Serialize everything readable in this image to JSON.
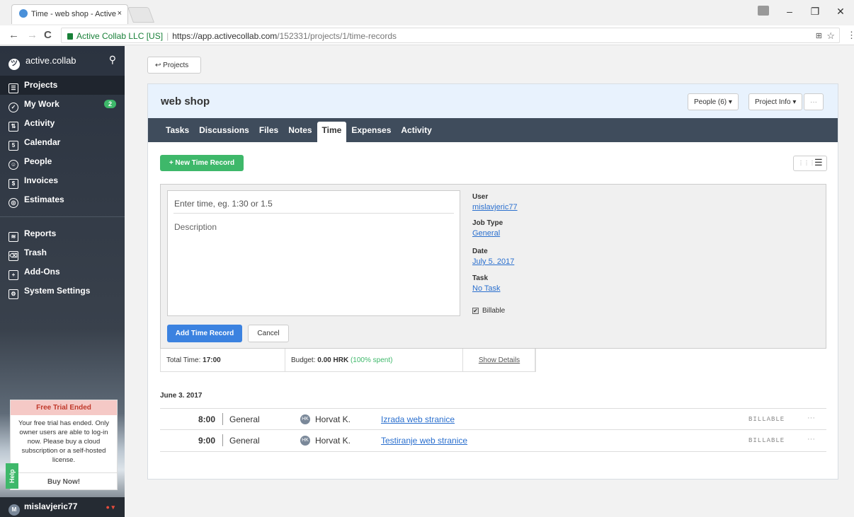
{
  "browser": {
    "tab_title": "Time - web shop - Active",
    "tab_close": "×",
    "security_label": "Active Collab LLC [US]",
    "url_base": "https://app.activecollab.com",
    "url_path": "/152331/projects/1/time-records",
    "back_glyph": "←",
    "forward_glyph": "→",
    "reload_glyph": "C",
    "star_glyph": "☆",
    "translate_glyph": "⊞",
    "menu_glyph": "⋮",
    "minimize_glyph": "–",
    "restore_glyph": "❐",
    "close_glyph": "✕"
  },
  "sidebar": {
    "brand": "active.collab",
    "logo_glyph": "ツ",
    "search_glyph": "⚲",
    "items": [
      {
        "label": "Projects",
        "glyph": "☰"
      },
      {
        "label": "My Work",
        "glyph": "✓",
        "badge": "2"
      },
      {
        "label": "Activity",
        "glyph": "⇅"
      },
      {
        "label": "Calendar",
        "glyph": "5"
      },
      {
        "label": "People",
        "glyph": "☺"
      },
      {
        "label": "Invoices",
        "glyph": "$"
      },
      {
        "label": "Estimates",
        "glyph": "◎"
      },
      {
        "label": "Reports",
        "glyph": "≋"
      },
      {
        "label": "Trash",
        "glyph": "⌫"
      },
      {
        "label": "Add-Ons",
        "glyph": "+"
      },
      {
        "label": "System Settings",
        "glyph": "⚙"
      }
    ],
    "trial": {
      "heading": "Free Trial Ended",
      "body": "Your free trial has ended. Only owner users are able to log-in now. Please buy a cloud subscription or a self-hosted license.",
      "buy": "Buy Now!"
    },
    "help": "Help",
    "user": {
      "initial": "M",
      "name": "mislavjeric77",
      "status_glyph": "● ▾"
    }
  },
  "main": {
    "back_label": "↩ Projects",
    "project_title": "web shop",
    "people_btn": "People (6) ▾",
    "info_btn": "Project Info ▾",
    "more_btn": "···",
    "tabs": [
      "Tasks",
      "Discussions",
      "Files",
      "Notes",
      "Time",
      "Expenses",
      "Activity"
    ],
    "active_tab": "Time",
    "new_record": "+ New Time Record",
    "grid_glyph": "⋮⋮⋮",
    "list_glyph": "☰",
    "form": {
      "time_placeholder": "Enter time, eg. 1:30 or 1.5",
      "description_placeholder": "Description",
      "user_label": "User",
      "user_value": "mislavjeric77",
      "job_type_label": "Job Type",
      "job_type_value": "General",
      "date_label": "Date",
      "date_value": "July 5. 2017",
      "task_label": "Task",
      "task_value": "No Task",
      "billable_label": "Billable",
      "check_glyph": "✔",
      "add_btn": "Add Time Record",
      "cancel_btn": "Cancel"
    },
    "totals": {
      "total_label": "Total Time:",
      "total_value": "17:00",
      "budget_label": "Budget:",
      "budget_value": "0.00 HRK",
      "budget_spent": "(100% spent)",
      "details_link": "Show Details"
    },
    "day_label": "June 3. 2017",
    "records": [
      {
        "duration": "8:00",
        "type": "General",
        "user_initials": "HK",
        "user": "Horvat K.",
        "task": "Izrada web stranice",
        "billable": "BILLABLE",
        "more": "···"
      },
      {
        "duration": "9:00",
        "type": "General",
        "user_initials": "HK",
        "user": "Horvat K.",
        "task": "Testiranje web stranice",
        "billable": "BILLABLE",
        "more": "···"
      }
    ]
  }
}
